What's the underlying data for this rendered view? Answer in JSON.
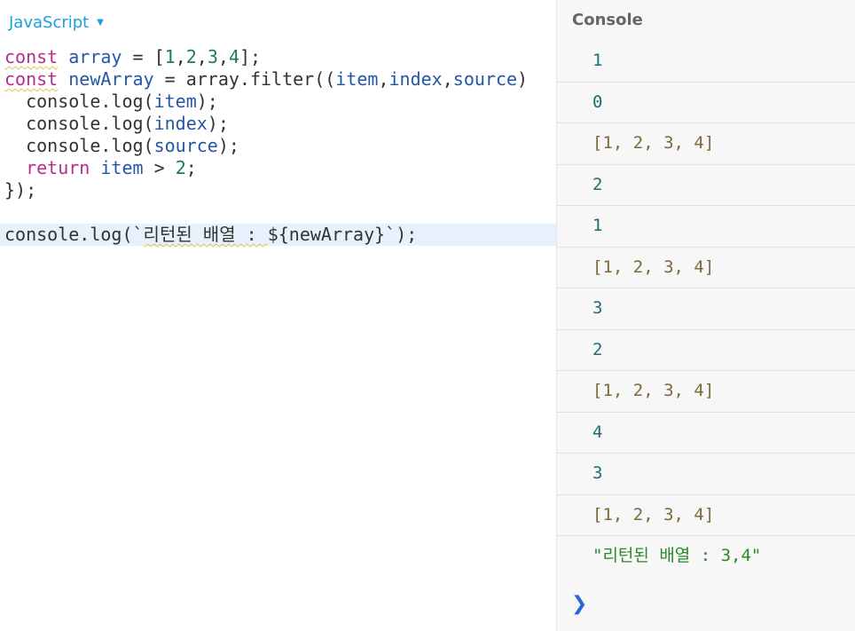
{
  "editor": {
    "language": "JavaScript",
    "lines": [
      [
        {
          "t": "const",
          "c": "kw",
          "sq": true
        },
        {
          "t": " "
        },
        {
          "t": "array",
          "c": "var"
        },
        {
          "t": " = ["
        },
        {
          "t": "1",
          "c": "num"
        },
        {
          "t": ","
        },
        {
          "t": "2",
          "c": "num"
        },
        {
          "t": ","
        },
        {
          "t": "3",
          "c": "num"
        },
        {
          "t": ","
        },
        {
          "t": "4",
          "c": "num"
        },
        {
          "t": "];"
        }
      ],
      [
        {
          "t": "const",
          "c": "kw",
          "sq": true
        },
        {
          "t": " "
        },
        {
          "t": "newArray",
          "c": "var"
        },
        {
          "t": " = array.filter(("
        },
        {
          "t": "item",
          "c": "var"
        },
        {
          "t": ","
        },
        {
          "t": "index",
          "c": "var"
        },
        {
          "t": ","
        },
        {
          "t": "source",
          "c": "var"
        },
        {
          "t": ")"
        }
      ],
      [
        {
          "t": "  console.log("
        },
        {
          "t": "item",
          "c": "var"
        },
        {
          "t": ");"
        }
      ],
      [
        {
          "t": "  console.log("
        },
        {
          "t": "index",
          "c": "var"
        },
        {
          "t": ");"
        }
      ],
      [
        {
          "t": "  console.log("
        },
        {
          "t": "source",
          "c": "var"
        },
        {
          "t": ");"
        }
      ],
      [
        {
          "t": "  "
        },
        {
          "t": "return",
          "c": "kw"
        },
        {
          "t": " "
        },
        {
          "t": "item",
          "c": "var"
        },
        {
          "t": " > "
        },
        {
          "t": "2",
          "c": "num"
        },
        {
          "t": ";"
        }
      ],
      [
        {
          "t": "});"
        }
      ],
      [],
      [
        {
          "t": "console.log(`"
        },
        {
          "t": "리턴된 배열 : ",
          "sq": true
        },
        {
          "t": "${newArray}`);"
        }
      ]
    ],
    "active_line": 8
  },
  "console": {
    "title": "Console",
    "logs": [
      {
        "text": "1",
        "type": "num"
      },
      {
        "text": "0",
        "type": "num"
      },
      {
        "text": "[1, 2, 3, 4]",
        "type": "arr"
      },
      {
        "text": "2",
        "type": "num"
      },
      {
        "text": "1",
        "type": "num"
      },
      {
        "text": "[1, 2, 3, 4]",
        "type": "arr"
      },
      {
        "text": "3",
        "type": "num"
      },
      {
        "text": "2",
        "type": "num"
      },
      {
        "text": "[1, 2, 3, 4]",
        "type": "arr"
      },
      {
        "text": "4",
        "type": "num"
      },
      {
        "text": "3",
        "type": "num"
      },
      {
        "text": "[1, 2, 3, 4]",
        "type": "arr"
      },
      {
        "text": "\"리턴된 배열 : 3,4\"",
        "type": "str"
      }
    ],
    "prompt_glyph": "❯"
  }
}
